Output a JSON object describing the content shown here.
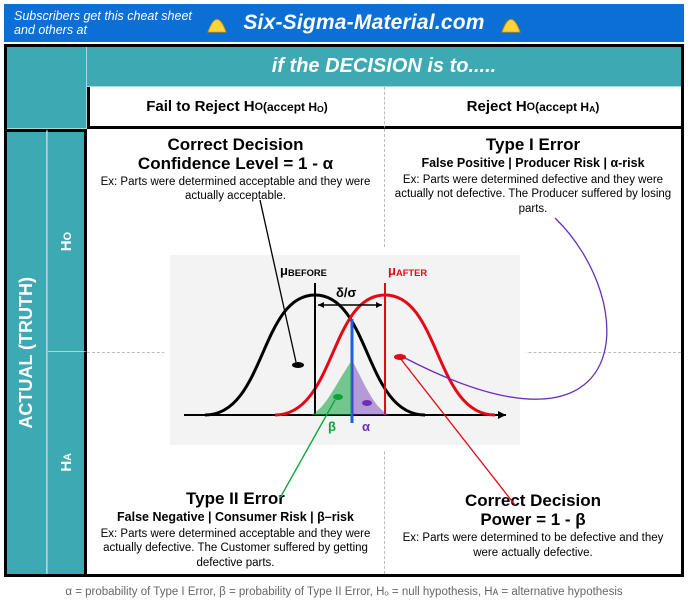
{
  "titlebar": {
    "subscribe": "Subscribers get this cheat sheet and others at",
    "site": "Six-Sigma-Material.com"
  },
  "headers": {
    "decision": "if the DECISION is to.....",
    "col_fail": "Fail to Reject H",
    "col_fail_sub": "O",
    "col_fail_paren": " (accept H",
    "col_fail_paren_sub": "O",
    "col_fail_paren_end": ")",
    "col_reject": "Reject H",
    "col_reject_sub": "O",
    "col_reject_paren": " (accept H",
    "col_reject_paren_sub": "A",
    "col_reject_paren_end": ")",
    "row_main": "ACTUAL (TRUTH)",
    "row_h0": "H",
    "row_h0_sub": "O",
    "row_ha": "H",
    "row_ha_sub": "A"
  },
  "quad": {
    "tl": {
      "title": "Correct Decision",
      "sub": "Confidence Level = 1 - α",
      "ex": "Ex: Parts were determined acceptable and they were actually acceptable."
    },
    "tr": {
      "title": "Type I Error",
      "sub": "False Positive | Producer Risk | α-risk",
      "ex": "Ex: Parts were determined defective and they were actually not defective. The Producer suffered by losing parts."
    },
    "bl": {
      "title": "Type II Error",
      "sub": "False Negative | Consumer Risk | β–risk",
      "ex": "Ex: Parts were determined acceptable and they were actually defective. The Customer suffered by getting defective parts."
    },
    "br": {
      "title": "Correct Decision",
      "sub": "Power = 1 - β",
      "ex": "Ex: Parts were determined to be defective and they were actually defective."
    }
  },
  "figure": {
    "mu_before": "μ",
    "mu_before_sub": "BEFORE",
    "mu_after": "μ",
    "mu_after_sub": "AFTER",
    "delta": "δ/σ",
    "beta": "β",
    "alpha": "α"
  },
  "footnote": "α = probability of Type I Error,  β = probability of Type II Error, Hₒ = null hypothesis, Hᴀ = alternative hypothesis",
  "chart_data": {
    "type": "diagram",
    "description": "2x2 hypothesis-testing decision matrix with overlaid dual normal distributions",
    "rows": [
      {
        "truth": "H0",
        "decision": "Fail to Reject H0",
        "outcome": "Correct Decision",
        "metric": "Confidence Level = 1 - alpha"
      },
      {
        "truth": "H0",
        "decision": "Reject H0",
        "outcome": "Type I Error",
        "metric": "alpha-risk (Producer Risk, False Positive)"
      },
      {
        "truth": "HA",
        "decision": "Fail to Reject H0",
        "outcome": "Type II Error",
        "metric": "beta-risk (Consumer Risk, False Negative)"
      },
      {
        "truth": "HA",
        "decision": "Reject H0",
        "outcome": "Correct Decision",
        "metric": "Power = 1 - beta"
      }
    ],
    "distributions": {
      "before": {
        "label": "mu_BEFORE",
        "color": "#000000"
      },
      "after": {
        "label": "mu_AFTER",
        "color": "#e30916"
      },
      "separation_label": "delta/sigma",
      "critical_boundary_color": "#1b5fe3",
      "regions": [
        {
          "name": "beta",
          "color": "#0aa33a",
          "side": "left_of_critical_under_after"
        },
        {
          "name": "alpha",
          "color": "#6b2fb8",
          "side": "right_of_critical_under_before"
        }
      ]
    }
  }
}
